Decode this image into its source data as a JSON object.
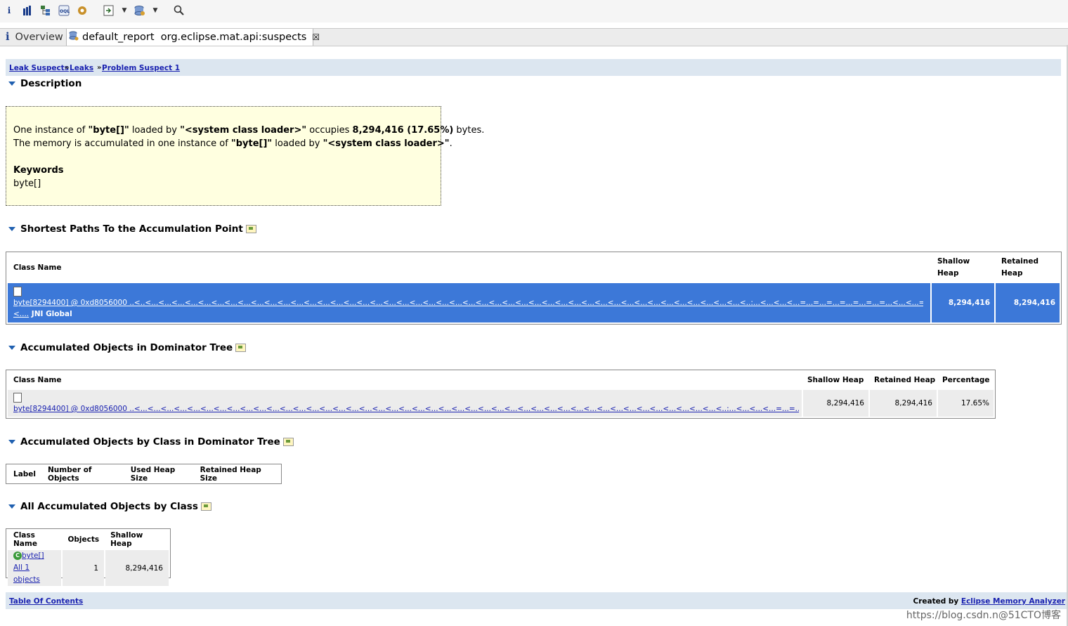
{
  "toolbar": {
    "items": [
      "info-icon",
      "bar-chart-icon",
      "tree-icon",
      "oql-icon",
      "gear-icon",
      "open-icon",
      "dropdown-icon",
      "db-icon",
      "dropdown-icon",
      "search-icon"
    ]
  },
  "tabs": [
    {
      "label": "Overview"
    },
    {
      "label": "default_report  org.eclipse.mat.api:suspects",
      "close": "☒"
    }
  ],
  "breadcrumb": {
    "items": [
      "Leak Suspects",
      "Leaks",
      "Problem Suspect 1"
    ],
    "sep": "»"
  },
  "description": {
    "heading": "Description",
    "line1_a": "One instance of ",
    "line1_b": "\"byte[]\"",
    "line1_c": " loaded by ",
    "line1_d": "\"<system class loader>\"",
    "line1_e": " occupies ",
    "line1_f": "8,294,416 (17.65%)",
    "line1_g": " bytes.",
    "line2_a": "The memory is accumulated in one instance of ",
    "line2_b": "\"byte[]\"",
    "line2_c": " loaded by ",
    "line2_d": "\"<system class loader>\"",
    "line2_e": ".",
    "keywords_label": "Keywords",
    "keywords_value": "byte[]"
  },
  "shortest_paths": {
    "heading": "Shortest Paths To the Accumulation Point",
    "cols": [
      "Class Name",
      "Shallow Heap",
      "Retained Heap"
    ],
    "row": {
      "link": "byte[8294400] @ 0xd8056000",
      "path": " ..<..<...<...<...<...<...<...<...<...<...<...<...<...<...<...<...<...<...<...<...<...<...<...<...<...<...<...<...<...<...<...<...<...<...<...<...<...<...<...<...<...<...<...<...<...<...<..:...<...<...<...=...=...=...=...=...=...=...<...<...=...=...=...",
      "path2": "<....",
      "suffix": " JNI Global",
      "shallow": "8,294,416",
      "retained": "8,294,416"
    }
  },
  "dominator": {
    "heading": "Accumulated Objects in Dominator Tree",
    "cols": [
      "Class Name",
      "Shallow Heap",
      "Retained Heap",
      "Percentage"
    ],
    "row": {
      "link": "byte[8294400] @ 0xd8056000",
      "path": " ..<...<...<...<...<...<...<...<...<...<...<...<...<...<...<...<...<...<...<...<...<...<...<...<...<...<...<...<...<...<...<...<...<...<...<...<...<...<...<...<...<...<...<...<...<..:...<...<...<...=...=...=...=...=...<...<...=...=...=...<...",
      "shallow": "8,294,416",
      "retained": "8,294,416",
      "percentage": "17.65%"
    }
  },
  "by_class_dominator": {
    "heading": "Accumulated Objects by Class in Dominator Tree",
    "cols": [
      "Label",
      "Number of Objects",
      "Used Heap Size",
      "Retained Heap Size"
    ]
  },
  "all_by_class": {
    "heading": "All Accumulated Objects by Class",
    "cols": [
      "Class Name",
      "Objects",
      "Shallow Heap"
    ],
    "row": {
      "icon_letter": "C",
      "link": "byte[]",
      "sub_link": "All 1 objects",
      "objects": "1",
      "shallow": "8,294,416"
    }
  },
  "footer": {
    "toc": "Table Of Contents",
    "created_by": "Created by ",
    "tool": "Eclipse Memory Analyzer"
  },
  "watermark": "https://blog.csdn.n@51CTO博客"
}
